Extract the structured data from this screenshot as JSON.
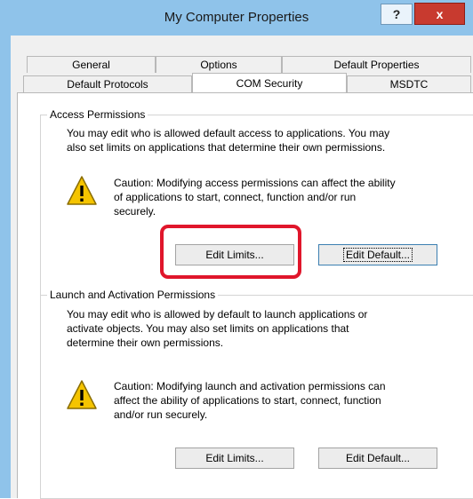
{
  "window": {
    "title": "My Computer Properties",
    "help_label": "?",
    "close_label": "x"
  },
  "tabs": {
    "row1": [
      "General",
      "Options",
      "Default Properties"
    ],
    "row2": [
      "Default Protocols",
      "COM Security",
      "MSDTC"
    ],
    "active": "COM Security"
  },
  "access": {
    "title": "Access Permissions",
    "description": [
      "You may edit who is allowed default access to applications. You may",
      "also set limits on applications that determine their own permissions."
    ],
    "caution": [
      "Caution: Modifying access permissions can affect the ability",
      "of applications to start, connect, function and/or run",
      "securely."
    ],
    "edit_limits": "Edit Limits...",
    "edit_default": "Edit Default..."
  },
  "launch": {
    "title": "Launch and Activation Permissions",
    "description": [
      "You may edit who is allowed by default to launch applications or",
      "activate objects. You may also set limits on applications that",
      "determine their own permissions."
    ],
    "caution": [
      "Caution: Modifying launch and activation permissions can",
      "affect the ability of applications to start, connect, function",
      "and/or run securely."
    ],
    "edit_limits": "Edit Limits...",
    "edit_default": "Edit Default..."
  },
  "icons": {
    "warning": "warning-triangle-icon",
    "close": "close-icon",
    "help": "help-icon"
  },
  "colors": {
    "titlebar": "#8fc3ea",
    "close_button": "#c83a2f",
    "highlight": "#e0162b"
  }
}
